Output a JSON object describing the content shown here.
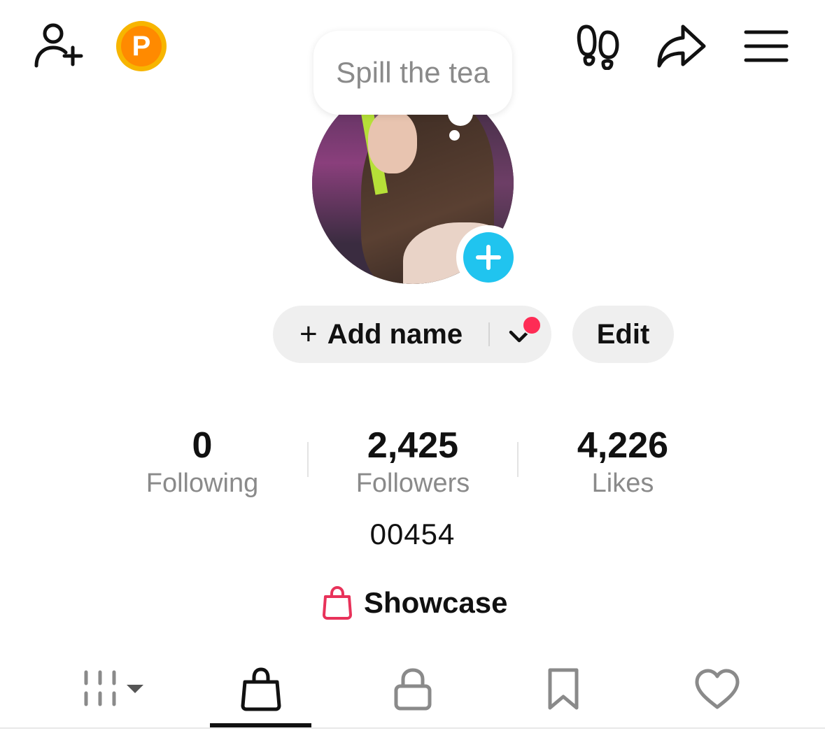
{
  "header": {
    "coin_letter": "P"
  },
  "bubble": {
    "text": "Spill the tea"
  },
  "profile": {
    "add_name_label": "Add name",
    "add_name_plus": "+",
    "edit_label": "Edit",
    "bio": "00454"
  },
  "stats": [
    {
      "value": "0",
      "label": "Following"
    },
    {
      "value": "2,425",
      "label": "Followers"
    },
    {
      "value": "4,226",
      "label": "Likes"
    }
  ],
  "showcase": {
    "label": "Showcase"
  },
  "tabs": [
    {
      "icon": "grid-icon"
    },
    {
      "icon": "shopping-bag-icon",
      "active": true
    },
    {
      "icon": "lock-icon"
    },
    {
      "icon": "bookmark-icon"
    },
    {
      "icon": "heart-icon"
    }
  ],
  "colors": {
    "accent_cyan": "#20c4ef",
    "notification_red": "#fe2c55",
    "coin_orange": "#ff8a00",
    "coin_gold": "#f7b500",
    "showcase_pink": "#e8325a",
    "muted_gray": "#8a8a8a"
  }
}
